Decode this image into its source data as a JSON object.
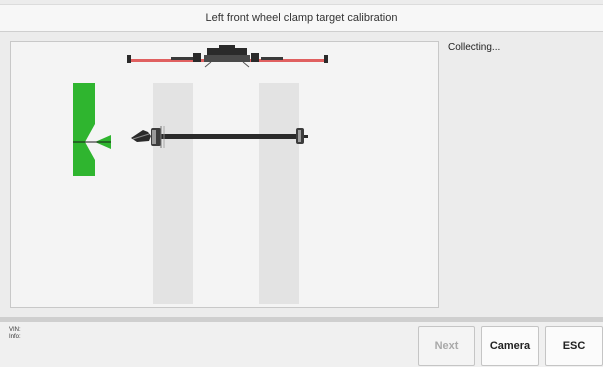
{
  "header": {
    "title": "Left front wheel clamp target calibration"
  },
  "main": {
    "status": "Collecting..."
  },
  "footer": {
    "vin_label": "VIN:",
    "info_label": "Info:",
    "buttons": {
      "next": "Next",
      "camera": "Camera",
      "esc": "ESC"
    }
  },
  "colors": {
    "target_green": "#2fb52f",
    "crossbar_red": "#e05252",
    "axle_dark": "#2a2a2a",
    "track_gray": "#e2e2e2"
  }
}
